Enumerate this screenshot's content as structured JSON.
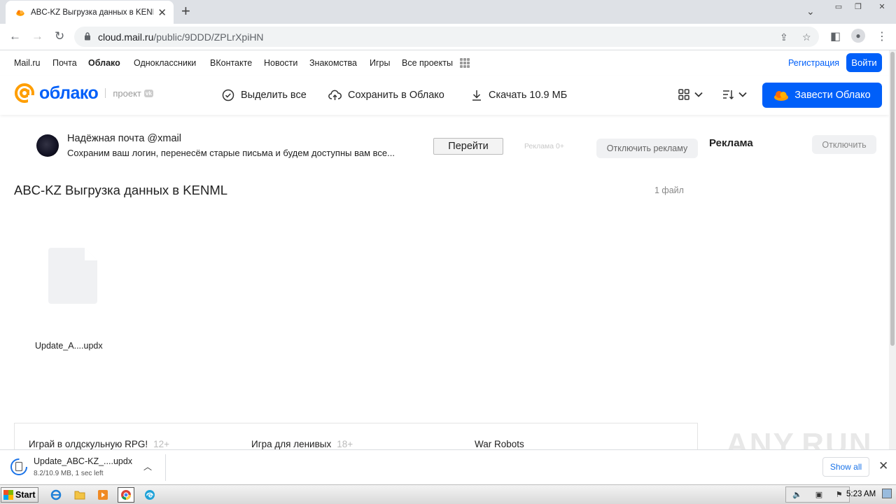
{
  "browser": {
    "tab_title": "ABC-KZ Выгрузка данных в KENML",
    "url_domain": "cloud.mail.ru",
    "url_path": "/public/9DDD/ZPLrXpiHN"
  },
  "portal_nav": {
    "items": [
      "Mail.ru",
      "Почта",
      "Облако",
      "Одноклассники",
      "ВКонтакте",
      "Новости",
      "Знакомства",
      "Игры",
      "Все проекты"
    ],
    "register": "Регистрация",
    "login": "Войти"
  },
  "cloud_header": {
    "logo_text": "облако",
    "project_label": "проект",
    "vk_badge": "vk",
    "select_all": "Выделить все",
    "save_to_cloud": "Сохранить в Облако",
    "download": "Скачать 10.9 МБ",
    "get_cloud": "Завести Облако"
  },
  "ad": {
    "title": "Надёжная почта @xmail",
    "text": "Сохраним ваш логин, перенесём старые письма и будем доступны вам все...",
    "go_button": "Перейти",
    "ad_label": "Реклама  0+",
    "disable_ads": "Отключить рекламу",
    "side_title": "Реклама",
    "side_disable": "Отключить"
  },
  "folder": {
    "title": "ABC-KZ Выгрузка данных в KENML",
    "file_count": "1 файл",
    "files": [
      {
        "name": "Update_A....updx"
      }
    ]
  },
  "games": [
    {
      "name": "Играй в олдскульную RPG!",
      "age": "12+"
    },
    {
      "name": "Игра для ленивых",
      "age": "18+"
    },
    {
      "name": "War Robots",
      "age": ""
    }
  ],
  "download_shelf": {
    "file_name": "Update_ABC-KZ_....updx",
    "status": "8.2/10.9 MB, 1 sec left",
    "show_all": "Show all"
  },
  "taskbar": {
    "start": "Start",
    "clock": "5:23 AM"
  },
  "watermark": "ANY.RUN",
  "colors": {
    "accent": "#005ff9",
    "logo_orange": "#ff9e00"
  }
}
